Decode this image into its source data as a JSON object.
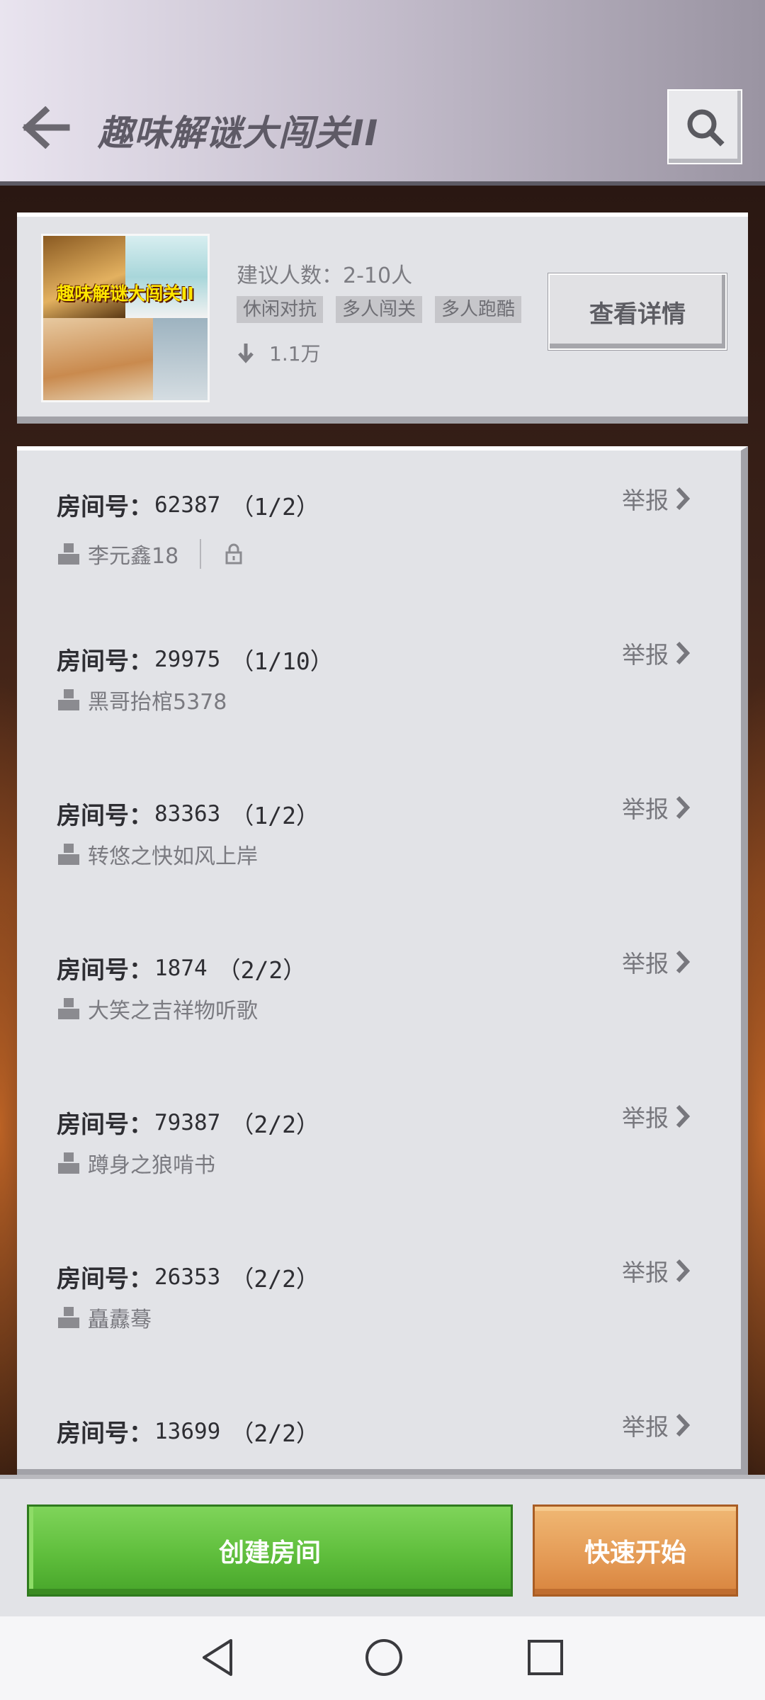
{
  "header": {
    "title": "趣味解谜大闯关II",
    "icons": {
      "back": "arrow-left-icon",
      "search": "search-icon"
    }
  },
  "game": {
    "thumbnail": {
      "title": "趣味解谜大闯关II"
    },
    "recommend_players": "建议人数：2-10人",
    "tags": [
      "休闲对抗",
      "多人闯关",
      "多人跑酷"
    ],
    "downloads": "1.1万",
    "detail_button": "查看详情"
  },
  "rooms": [
    {
      "label": "房间号：",
      "id": "62387",
      "count": "（1/2）",
      "owner": "李元鑫18",
      "report": "举报",
      "locked": true
    },
    {
      "label": "房间号：",
      "id": "29975",
      "count": "（1/10）",
      "owner": "黑哥抬棺5378",
      "report": "举报",
      "locked": false
    },
    {
      "label": "房间号：",
      "id": "83363",
      "count": "（1/2）",
      "owner": "转悠之快如风上岸",
      "report": "举报",
      "locked": false
    },
    {
      "label": "房间号：",
      "id": "1874",
      "count": "（2/2）",
      "owner": "大笑之吉祥物听歌",
      "report": "举报",
      "locked": false
    },
    {
      "label": "房间号：",
      "id": "79387",
      "count": "（2/2）",
      "owner": "蹲身之狼啃书",
      "report": "举报",
      "locked": false
    },
    {
      "label": "房间号：",
      "id": "26353",
      "count": "（2/2）",
      "owner": "矗纛蓦",
      "report": "举报",
      "locked": false
    },
    {
      "label": "房间号：",
      "id": "13699",
      "count": "（2/2）",
      "owner": "",
      "report": "举报",
      "locked": false
    }
  ],
  "bottom": {
    "create_room": "创建房间",
    "quick_start": "快速开始"
  },
  "colors": {
    "create_green": "#5fbe3c",
    "quick_orange": "#e49a55",
    "panel_gray": "#e2e3e7"
  }
}
